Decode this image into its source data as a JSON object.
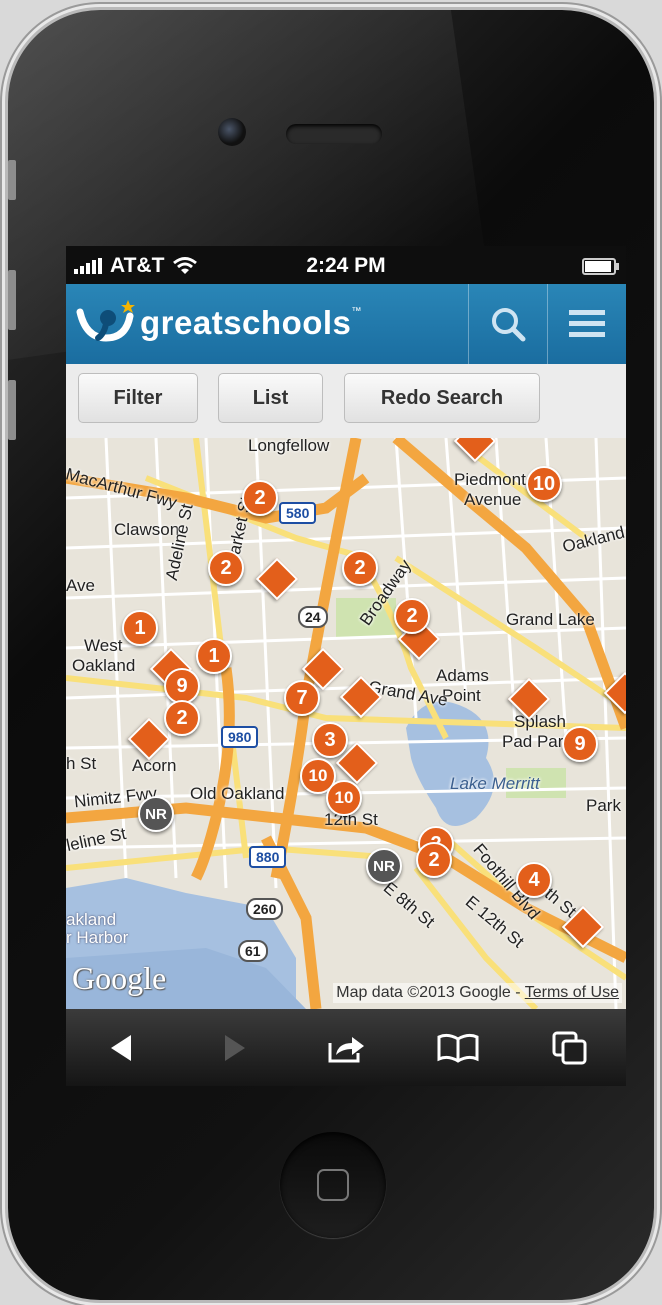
{
  "status_bar": {
    "carrier": "AT&T",
    "time": "2:24 PM",
    "battery_level": 0.85
  },
  "header": {
    "brand_part1": "great",
    "brand_part2": "schools",
    "trademark": "™",
    "search_icon": "search-icon",
    "menu_icon": "hamburger-icon"
  },
  "toolbar": {
    "filter_label": "Filter",
    "list_label": "List",
    "redo_label": "Redo Search"
  },
  "map": {
    "labels": {
      "longfellow": "Longfellow",
      "macarthur": "MacArthur Fwy",
      "clawson": "Clawson",
      "piedmont": "Piedmont",
      "avenue": "Avenue",
      "oakland_top": "Oakland",
      "adeline": "Adeline St",
      "market": "Market St",
      "broadway": "Broadway",
      "grand_lake": "Grand Lake",
      "west_oakland_1": "West",
      "west_oakland_2": "Oakland",
      "ave_left": "Ave",
      "adams_point_1": "Adams",
      "adams_point_2": "Point",
      "grand_ave": "Grand Ave",
      "acorn": "Acorn",
      "splash_1": "Splash",
      "splash_2": "Pad Park",
      "lake_merritt": "Lake Merritt",
      "old_oakland": "Old Oakland",
      "nimitz": "Nimitz Fwy",
      "st_left": "h St",
      "twelfth": "12th St",
      "park": "Park",
      "adeline_bottom": "leline St",
      "foothill": "Foothill Blvd",
      "e8th": "E 8th St",
      "e12th": "E 12th St",
      "eighth_right": "8th St",
      "oakland_harbor_1": "akland",
      "oakland_harbor_2": "r Harbor"
    },
    "shields": {
      "i580": "580",
      "r24": "24",
      "i980": "980",
      "i880": "880",
      "r260": "260",
      "r61": "61"
    },
    "pins": [
      "2",
      "10",
      "2",
      "2",
      "2",
      "1",
      "1",
      "9",
      "2",
      "7",
      "3",
      "10",
      "10",
      "9",
      "4",
      "2",
      "2",
      "NR",
      "NR"
    ],
    "google_logo": "Google",
    "attribution": "Map data ©2013 Google - ",
    "terms": "Terms of Use"
  },
  "colors": {
    "brand_blue": "#1a6da0",
    "pin_orange": "#e35f1b"
  }
}
